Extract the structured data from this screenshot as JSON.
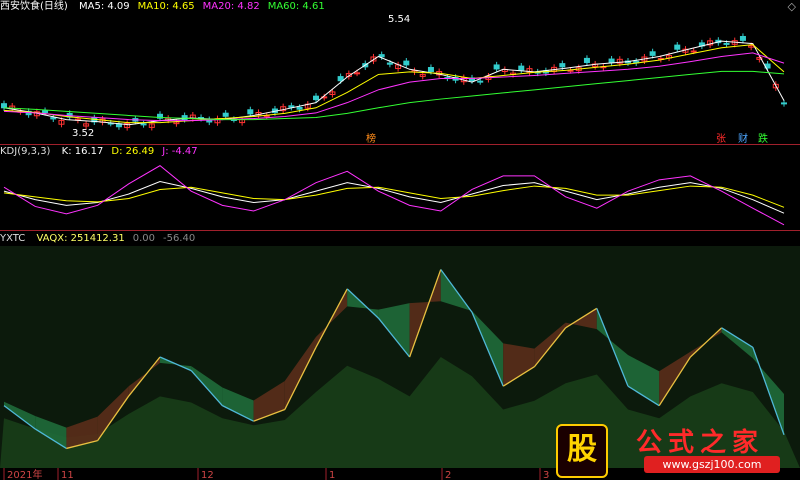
{
  "panels": {
    "main": {
      "title": "西安饮食(日线)",
      "indicators": [
        {
          "label": "MA5: 4.09",
          "color": "#ffffff"
        },
        {
          "label": "MA10: 4.65",
          "color": "#ffff00"
        },
        {
          "label": "MA20: 4.82",
          "color": "#ff33ff"
        },
        {
          "label": "MA60: 4.61",
          "color": "#33ff33"
        }
      ],
      "high_label": "5.54",
      "low_label": "3.52",
      "markers": [
        {
          "text": "榜",
          "color": "#ff8c1a"
        },
        {
          "text": "张",
          "color": "#ff2a2a"
        },
        {
          "text": "财",
          "color": "#4da6ff"
        },
        {
          "text": "跌",
          "color": "#33ff33"
        }
      ]
    },
    "kdj": {
      "title": "KDJ(9,3,3)",
      "values": [
        {
          "label": "K: 16.17",
          "color": "#ffffff"
        },
        {
          "label": "D: 26.49",
          "color": "#ffff00"
        },
        {
          "label": "J: -4.47",
          "color": "#ff33ff"
        }
      ]
    },
    "yxtc": {
      "title": "YXTC",
      "values": [
        {
          "label": "VAQX: 251412.31",
          "color": "#ffff66"
        },
        {
          "label": "0.00",
          "color": "#888888"
        },
        {
          "label": "-56.40",
          "color": "#888888"
        }
      ]
    }
  },
  "xaxis": {
    "labels": [
      "2021年",
      "11",
      "12",
      "1",
      "2",
      "3"
    ]
  },
  "watermark": {
    "badge": "股",
    "name": "公式之家",
    "url": "www.gszj100.com"
  },
  "close_glyph": "◇",
  "chart_data": [
    {
      "type": "line",
      "title": "西安饮食(日线)",
      "series": [
        {
          "name": "MA5",
          "values": [
            3.95,
            3.85,
            3.72,
            3.68,
            3.62,
            3.7,
            3.75,
            3.72,
            3.8,
            3.92,
            4.05,
            4.55,
            4.95,
            4.7,
            4.6,
            4.45,
            4.7,
            4.65,
            4.72,
            4.8,
            4.85,
            4.95,
            5.1,
            5.25,
            5.2,
            4.09
          ]
        },
        {
          "name": "MA10",
          "values": [
            3.9,
            3.86,
            3.78,
            3.72,
            3.66,
            3.66,
            3.7,
            3.74,
            3.78,
            3.84,
            3.95,
            4.25,
            4.6,
            4.65,
            4.62,
            4.52,
            4.58,
            4.64,
            4.68,
            4.74,
            4.8,
            4.88,
            5.0,
            5.12,
            5.18,
            4.65
          ]
        },
        {
          "name": "MA20",
          "values": [
            3.88,
            3.85,
            3.8,
            3.76,
            3.72,
            3.7,
            3.7,
            3.72,
            3.74,
            3.78,
            3.85,
            4.05,
            4.3,
            4.45,
            4.52,
            4.52,
            4.55,
            4.58,
            4.62,
            4.66,
            4.7,
            4.76,
            4.85,
            4.95,
            5.02,
            4.82
          ]
        },
        {
          "name": "MA60",
          "values": [
            3.95,
            3.92,
            3.88,
            3.84,
            3.8,
            3.76,
            3.74,
            3.72,
            3.72,
            3.74,
            3.76,
            3.84,
            3.95,
            4.05,
            4.12,
            4.18,
            4.24,
            4.3,
            4.36,
            4.42,
            4.48,
            4.54,
            4.6,
            4.66,
            4.66,
            4.61
          ]
        }
      ],
      "annotations": [
        "5.54",
        "3.52"
      ]
    },
    {
      "type": "line",
      "title": "KDJ(9,3,3)",
      "series": [
        {
          "name": "K",
          "values": [
            55,
            40,
            30,
            35,
            50,
            72,
            60,
            45,
            35,
            40,
            55,
            70,
            60,
            45,
            35,
            50,
            65,
            70,
            55,
            40,
            50,
            62,
            70,
            60,
            40,
            16.17
          ]
        },
        {
          "name": "D",
          "values": [
            52,
            45,
            38,
            36,
            42,
            58,
            62,
            52,
            42,
            40,
            48,
            60,
            62,
            52,
            42,
            46,
            56,
            64,
            60,
            48,
            48,
            56,
            64,
            62,
            48,
            26.49
          ]
        },
        {
          "name": "J",
          "values": [
            62,
            28,
            15,
            30,
            68,
            100,
            55,
            30,
            20,
            40,
            70,
            90,
            55,
            30,
            20,
            58,
            82,
            82,
            45,
            25,
            55,
            75,
            82,
            55,
            25,
            -4.47
          ]
        }
      ]
    },
    {
      "type": "area",
      "title": "YXTC",
      "series": [
        {
          "name": "VAQX",
          "values": [
            30,
            18,
            8,
            12,
            35,
            55,
            48,
            30,
            22,
            28,
            60,
            90,
            75,
            55,
            100,
            78,
            40,
            50,
            70,
            80,
            40,
            30,
            55,
            70,
            60,
            15
          ]
        }
      ]
    }
  ]
}
